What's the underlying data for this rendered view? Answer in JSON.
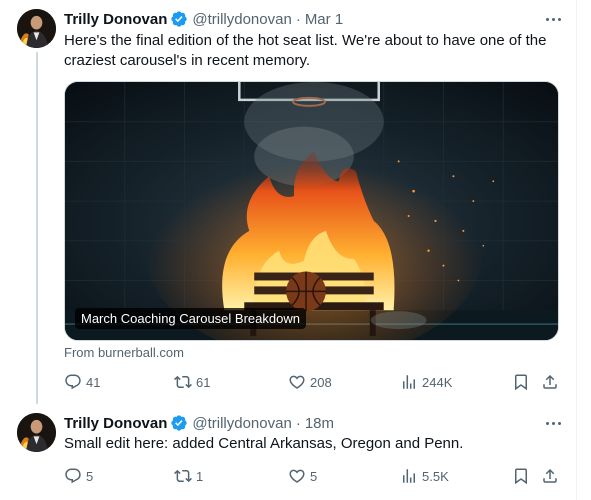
{
  "colors": {
    "verified": "#1d9bf0",
    "secondary_text": "#536471",
    "primary_text": "#0f1419",
    "divider": "#cfd9de"
  },
  "tweets": [
    {
      "author_name": "Trilly Donovan",
      "handle": "@trillydonovan",
      "separator": "·",
      "time": "Mar 1",
      "text": "Here's the final edition of the hot seat list. We're about to have one of the craziest carousel's in recent memory.",
      "media_caption": "March Coaching Carousel Breakdown",
      "source": "From burnerball.com",
      "replies": "41",
      "retweets": "61",
      "likes": "208",
      "views": "244K",
      "icons": [
        "verified-badge-icon",
        "more-icon",
        "reply-icon",
        "retweet-icon",
        "like-icon",
        "views-icon",
        "bookmark-icon",
        "share-icon"
      ]
    },
    {
      "author_name": "Trilly Donovan",
      "handle": "@trillydonovan",
      "separator": "·",
      "time": "18m",
      "text": "Small edit here: added Central Arkansas, Oregon and Penn.",
      "replies": "5",
      "retweets": "1",
      "likes": "5",
      "views": "5.5K",
      "icons": [
        "verified-badge-icon",
        "more-icon",
        "reply-icon",
        "retweet-icon",
        "like-icon",
        "views-icon",
        "bookmark-icon",
        "share-icon"
      ]
    }
  ]
}
